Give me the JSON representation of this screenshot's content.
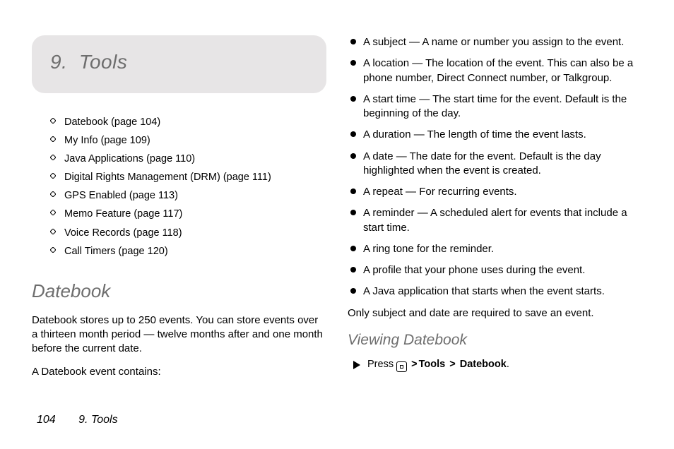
{
  "chapter": {
    "number": "9.",
    "title": "Tools"
  },
  "toc": [
    "Datebook (page 104)",
    "My Info (page 109)",
    "Java Applications (page 110)",
    "Digital Rights Management (DRM) (page 111)",
    "GPS Enabled (page 113)",
    "Memo Feature (page 117)",
    "Voice Records (page 118)",
    "Call Timers (page 120)"
  ],
  "section": {
    "title": "Datebook",
    "intro": "Datebook stores up to 250 events. You can store events over a thirteen month period — twelve months after and one month before the current date.",
    "lead": "A Datebook event contains:"
  },
  "event_fields": [
    "A subject — A name or number you assign to the event.",
    "A location — The location of the event. This can also be a phone number, Direct Connect number, or Talkgroup.",
    "A start time — The start time for the event. Default is the beginning of the day.",
    "A duration — The length of time the event lasts.",
    "A date — The date for the event. Default is the day highlighted when the event is created.",
    "A repeat — For recurring events.",
    "A reminder — A scheduled alert for events that include a start time.",
    "A ring tone for the reminder.",
    "A profile that your phone uses during the event.",
    "A Java application that starts when the event starts."
  ],
  "required_note": "Only subject and date are required to save an event.",
  "subsection": {
    "title": "Viewing Datebook"
  },
  "step": {
    "verb": "Press",
    "path1": "Tools",
    "path2": "Datebook"
  },
  "footer": {
    "page": "104",
    "running": "9. Tools"
  }
}
